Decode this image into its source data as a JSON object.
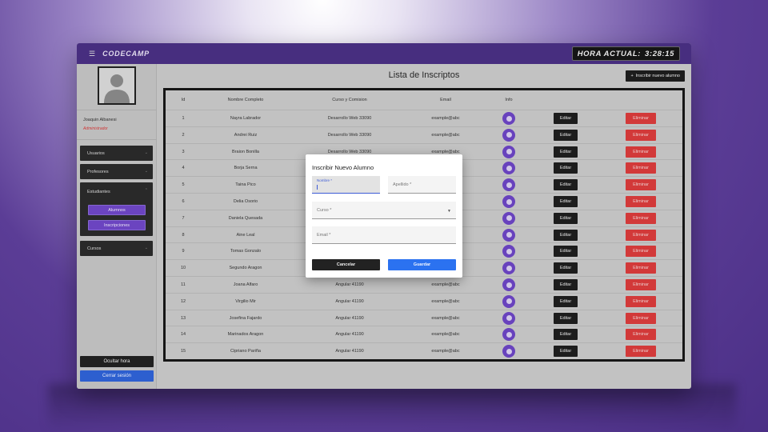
{
  "app": {
    "brand": "CODECAMP",
    "clock_label": "HORA ACTUAL:",
    "clock_value": "3:28:15"
  },
  "sidebar": {
    "user_name": "Joaquin Albanesi",
    "user_role": "Administrador",
    "items": [
      {
        "label": "Usuarios"
      },
      {
        "label": "Profesores"
      },
      {
        "label": "Estudiantes"
      },
      {
        "label": "Cursos"
      }
    ],
    "sub_items": [
      {
        "label": "Alumnos"
      },
      {
        "label": "Inscripciones"
      }
    ],
    "hide_clock_label": "Ocultar hora",
    "logout_label": "Cerrar sesión"
  },
  "main": {
    "title": "Lista de Inscriptos",
    "add_button_label": "Inscribir nuevo alumno"
  },
  "table": {
    "headers": {
      "id": "Id",
      "name": "Nombre Completo",
      "course": "Curso y Comision",
      "email": "Email",
      "info": "Info"
    },
    "edit_label": "Editar",
    "delete_label": "Eliminar",
    "rows": [
      {
        "id": "1",
        "name": "Nayra Labrador",
        "course": "Desarrollo Web 33090",
        "email": "example@abc"
      },
      {
        "id": "2",
        "name": "Andrei Ruiz",
        "course": "Desarrollo Web 33090",
        "email": "example@abc"
      },
      {
        "id": "3",
        "name": "Braion Bonilla",
        "course": "Desarrollo Web 33090",
        "email": "example@abc"
      },
      {
        "id": "4",
        "name": "Borja Serna",
        "course": "",
        "email": ""
      },
      {
        "id": "5",
        "name": "Taina Pico",
        "course": "",
        "email": ""
      },
      {
        "id": "6",
        "name": "Delia Osorio",
        "course": "",
        "email": ""
      },
      {
        "id": "7",
        "name": "Daniela Quesada",
        "course": "",
        "email": ""
      },
      {
        "id": "8",
        "name": "Aine Leal",
        "course": "",
        "email": ""
      },
      {
        "id": "9",
        "name": "Tomas Gonzalo",
        "course": "",
        "email": ""
      },
      {
        "id": "10",
        "name": "Segundo Aragon",
        "course": "",
        "email": ""
      },
      {
        "id": "11",
        "name": "Joana Alfaro",
        "course": "Angular 41190",
        "email": "example@abc"
      },
      {
        "id": "12",
        "name": "Virgilio Mir",
        "course": "Angular 41190",
        "email": "example@abc"
      },
      {
        "id": "13",
        "name": "Josefina Fajardo",
        "course": "Angular 41190",
        "email": "example@abc"
      },
      {
        "id": "14",
        "name": "Marinados Aragon",
        "course": "Angular 41190",
        "email": "example@abc"
      },
      {
        "id": "15",
        "name": "Cipriano Pariña",
        "course": "Angular 41190",
        "email": "example@abc"
      }
    ]
  },
  "modal": {
    "title": "Inscribir Nuevo Alumno",
    "first_name_label": "Nombre *",
    "last_name_label": "Apellido *",
    "course_label": "Curso *",
    "email_label": "Email *",
    "cancel_label": "Cancelar",
    "save_label": "Guardar"
  },
  "colors": {
    "topbar": "#4a3084",
    "accent_purple": "#6f47c7",
    "danger": "#d93b3b",
    "primary": "#2b72f0"
  }
}
